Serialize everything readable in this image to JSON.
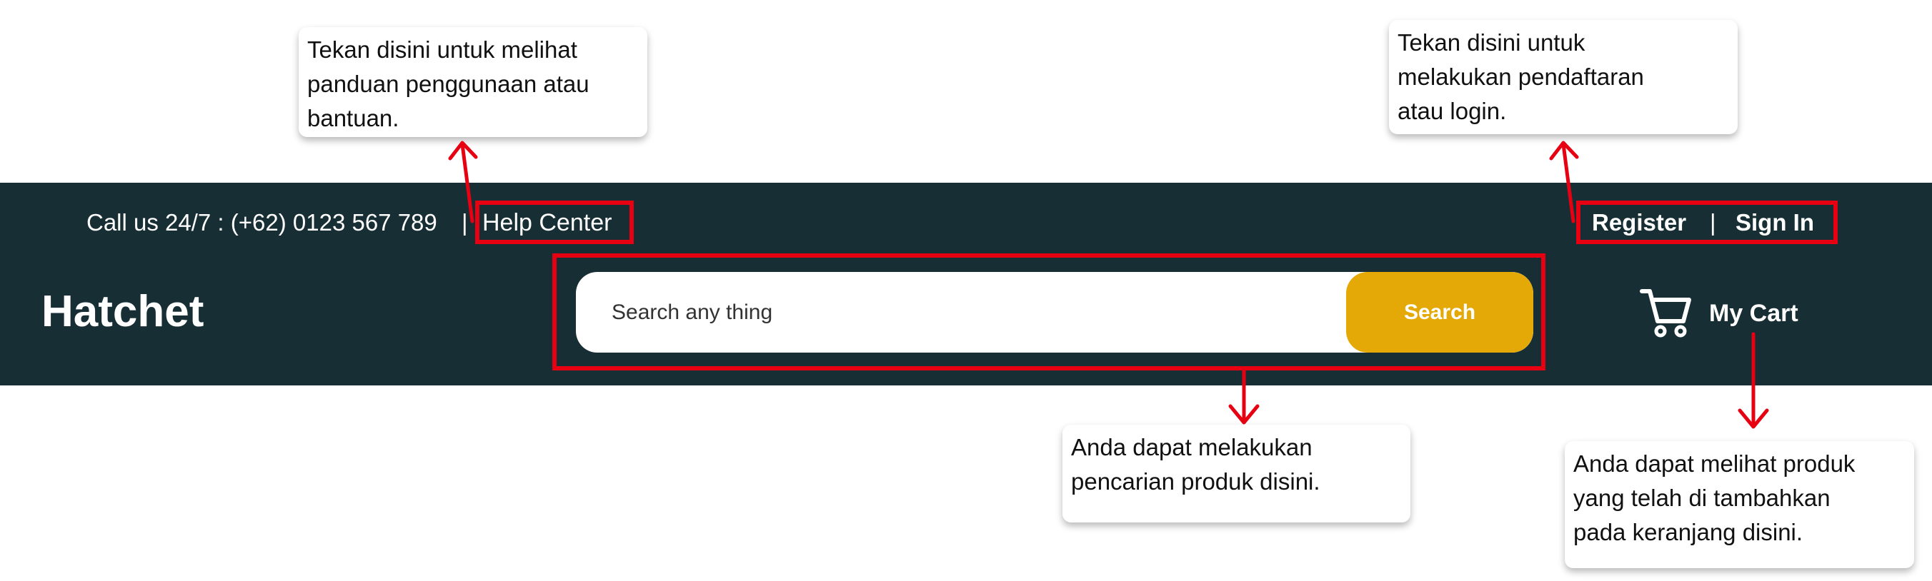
{
  "topbar": {
    "call_text": "Call us 24/7 : (+62) 0123 567 789",
    "separator": "|",
    "help_center": "Help Center",
    "register": "Register",
    "auth_separator": "|",
    "sign_in": "Sign In"
  },
  "brand": {
    "name": "Hatchet"
  },
  "search": {
    "placeholder": "Search any thing",
    "button_label": "Search"
  },
  "cart": {
    "icon": "shopping-cart-icon",
    "label": "My Cart"
  },
  "callouts": {
    "help": "Tekan disini untuk melihat\npanduan penggunaan atau\nbantuan.",
    "auth": "Tekan disini untuk\nmelakukan pendaftaran\natau login.",
    "search": "Anda dapat melakukan\npencarian produk disini.",
    "cart": "Anda dapat melihat produk\nyang telah di tambahkan\npada keranjang disini."
  },
  "colors": {
    "header_background": "#172f34",
    "search_button": "#e4a906",
    "annotation": "#e60012",
    "text_light": "#ffffff"
  }
}
